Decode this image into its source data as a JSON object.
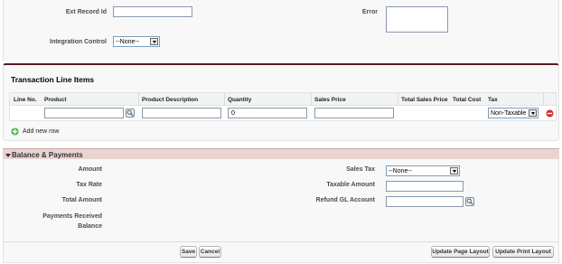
{
  "top": {
    "ext_record_id_label": "Ext Record Id",
    "ext_record_id_value": "",
    "error_label": "Error",
    "error_value": "",
    "integration_control_label": "Integration Control",
    "integration_control_value": "--None--"
  },
  "line_items": {
    "title": "Transaction Line Items",
    "columns": [
      "Line No.",
      "Product",
      "Product Description",
      "Quantity",
      "Sales Price",
      "Total Sales Price",
      "Total Cost",
      "Tax"
    ],
    "row": {
      "product": "",
      "description": "",
      "quantity": "0",
      "sales_price": "",
      "tax": "Non-Taxable"
    },
    "add_row_label": "Add new row"
  },
  "balance": {
    "title": "Balance & Payments",
    "left_labels": [
      "Amount",
      "Tax Rate",
      "Total Amount",
      "Payments Received",
      "Balance"
    ],
    "sales_tax_label": "Sales Tax",
    "sales_tax_value": "--None--",
    "taxable_amount_label": "Taxable Amount",
    "taxable_amount_value": "",
    "refund_gl_label": "Refund GL Account",
    "refund_gl_value": ""
  },
  "footer": {
    "save_label": "Save",
    "cancel_label": "Cancel",
    "update_page_layout_label": "Update Page Layout",
    "update_print_layout_label": "Update Print Layout"
  },
  "colors": {
    "section_accent": "#5b1a21",
    "balance_header": "#e9d4d2",
    "add_icon": "#4caf50",
    "remove_icon": "#d32f2f"
  }
}
